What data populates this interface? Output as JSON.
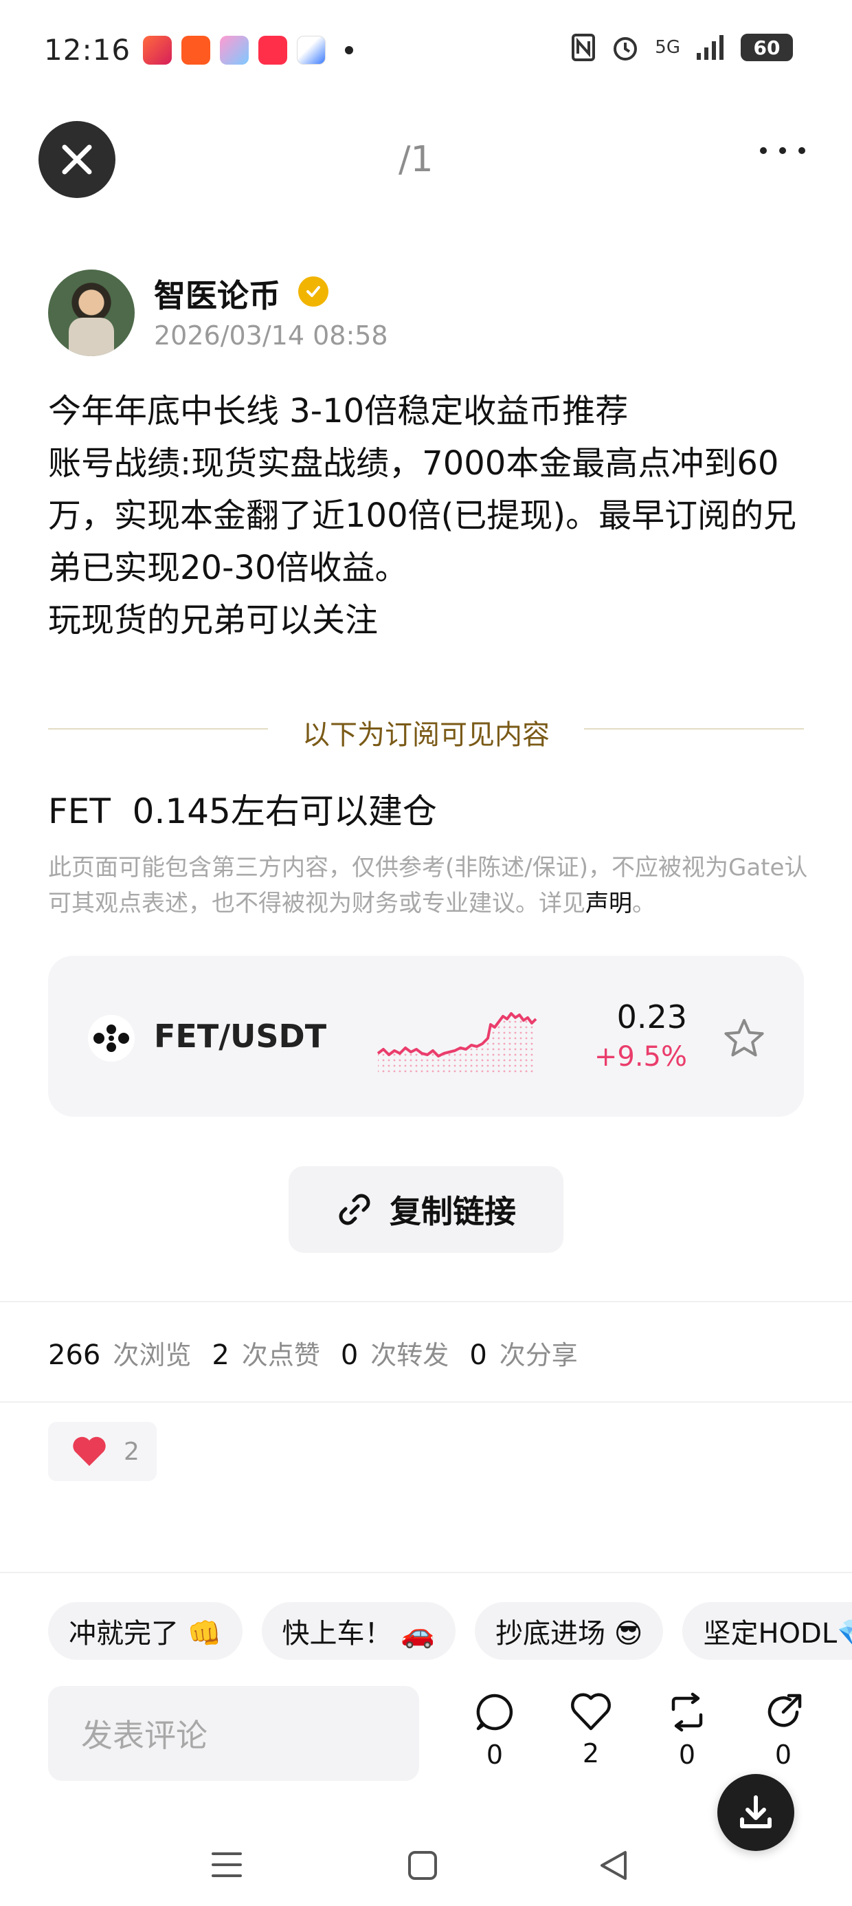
{
  "status_bar": {
    "time": "12:16",
    "network": "5G",
    "battery": "60"
  },
  "header": {
    "page_indicator": "/1"
  },
  "author": {
    "name": "智医论币",
    "timestamp": "2026/03/14 08:58"
  },
  "post": {
    "body": "今年年底中长线 3-10倍稳定收益币推荐\n账号战绩:现货实盘战绩，7000本金最高点冲到60万，实现本金翻了近100倍(已提现)。最早订阅的兄弟已实现20-30倍收益。\n玩现货的兄弟可以关注",
    "subscriber_divider": "以下为订阅可见内容",
    "subscriber_text": "FET  0.145左右可以建仓",
    "disclaimer": "此页面可能包含第三方内容，仅供参考(非陈述/保证)，不应被视为Gate认可其观点表述，也不得被视为财务或专业建议。详见",
    "disclaimer_link": "声明",
    "disclaimer_end": "。"
  },
  "ticker": {
    "pair": "FET/USDT",
    "price": "0.23",
    "change": "+9.5%",
    "color": "#ea3d6c"
  },
  "copy_link": {
    "label": "复制链接"
  },
  "stats": {
    "views": "266",
    "views_label": "次浏览",
    "likes": "2",
    "likes_label": "次点赞",
    "reposts": "0",
    "reposts_label": "次转发",
    "shares": "0",
    "shares_label": "次分享"
  },
  "reaction": {
    "count": "2"
  },
  "quick_replies": [
    "冲就完了 👊",
    "快上车！ 🚗",
    "抄底进场 😎",
    "坚定HODL💎"
  ],
  "comment": {
    "placeholder": "发表评论"
  },
  "actions": {
    "comments": "0",
    "likes": "2",
    "reposts": "0",
    "shares": "0"
  }
}
